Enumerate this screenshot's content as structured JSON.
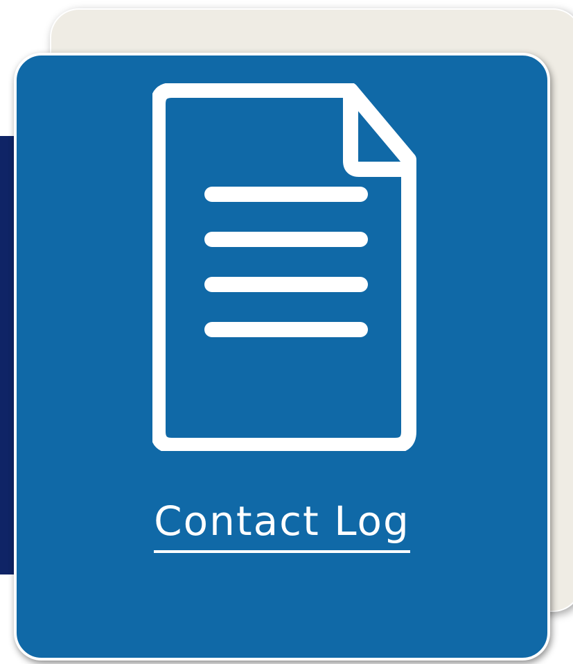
{
  "card": {
    "link_label": "Contact Log",
    "icon": "document-icon"
  },
  "colors": {
    "back_card": "#efece4",
    "side_strip": "#0f2466",
    "front_card": "#1069a7",
    "foreground": "#ffffff"
  }
}
